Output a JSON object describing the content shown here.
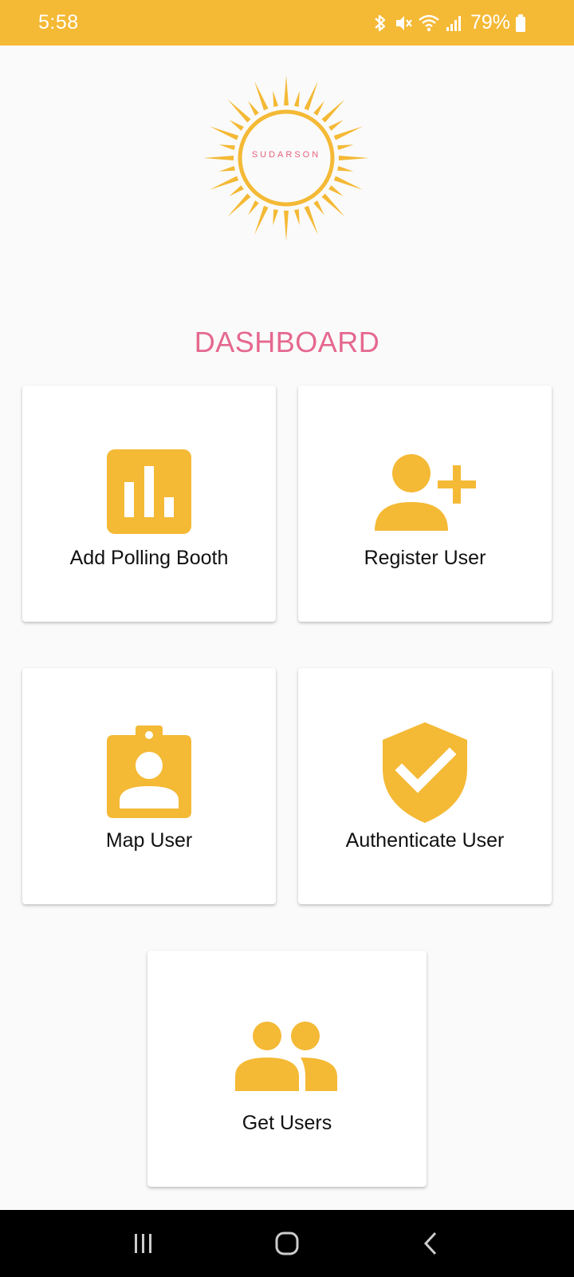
{
  "status_bar": {
    "time": "5:58",
    "battery": "79%",
    "icons": [
      "bluetooth-icon",
      "mute-icon",
      "wifi-icon",
      "signal-icon",
      "battery-icon"
    ]
  },
  "logo": {
    "text": "SUDARSON",
    "icon": "sun-logo"
  },
  "dashboard": {
    "title": "DASHBOARD",
    "cards": [
      {
        "label": "Add Polling Booth",
        "icon": "bar-chart-icon"
      },
      {
        "label": "Register User",
        "icon": "person-add-icon"
      },
      {
        "label": "Map User",
        "icon": "badge-icon"
      },
      {
        "label": "Authenticate User",
        "icon": "verified-shield-icon"
      },
      {
        "label": "Get Users",
        "icon": "group-icon"
      }
    ]
  },
  "nav_bar": {
    "buttons": [
      "recents-icon",
      "home-icon",
      "back-icon"
    ]
  },
  "colors": {
    "accent": "#f4b935",
    "title": "#e5688f",
    "background": "#fafafa",
    "card": "#ffffff"
  }
}
